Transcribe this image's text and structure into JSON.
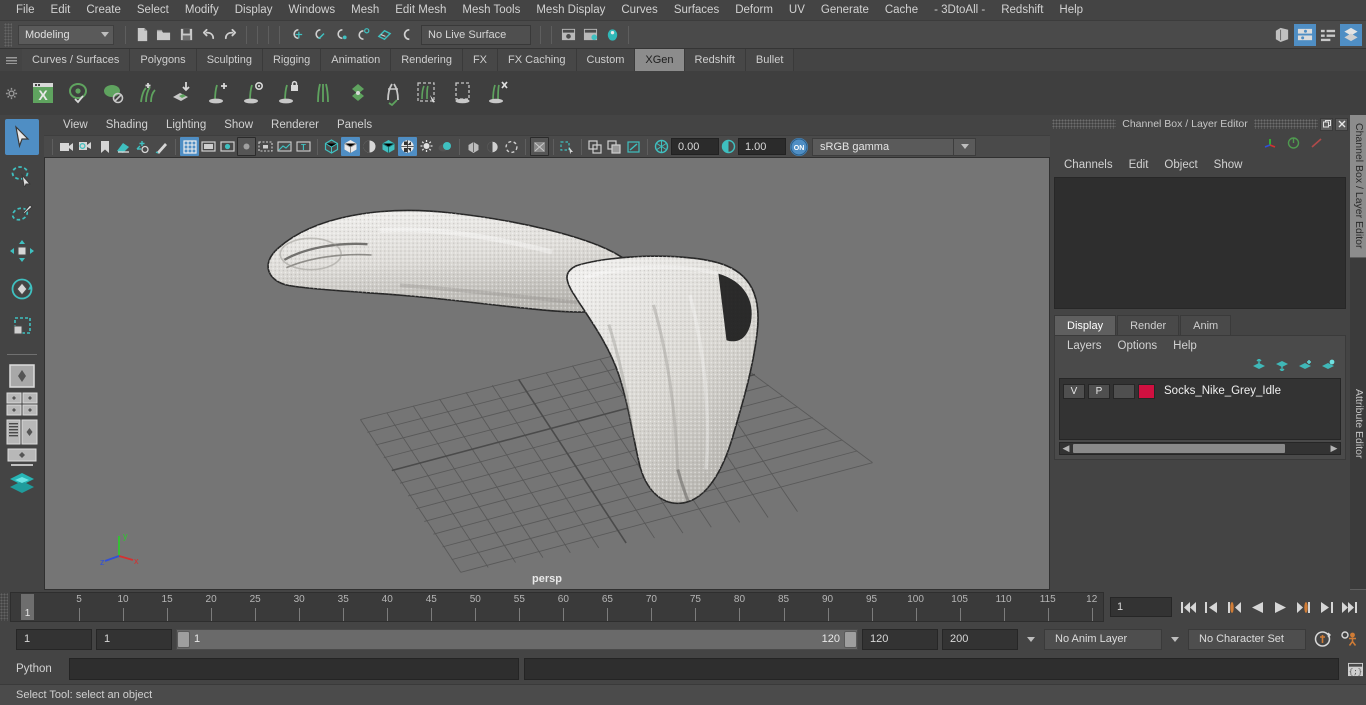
{
  "menubar": {
    "items": [
      "File",
      "Edit",
      "Create",
      "Select",
      "Modify",
      "Display",
      "Windows",
      "Mesh",
      "Edit Mesh",
      "Mesh Tools",
      "Mesh Display",
      "Curves",
      "Surfaces",
      "Deform",
      "UV",
      "Generate",
      "Cache",
      "- 3DtoAll -",
      "Redshift",
      "Help"
    ]
  },
  "statusbar": {
    "menuset": "Modeling",
    "live_surface": "No Live Surface",
    "icons": [
      "new-scene-icon",
      "open-scene-icon",
      "save-scene-icon",
      "undo-icon",
      "redo-icon",
      "snap-to-grid-icon",
      "snap-to-curve-icon",
      "snap-to-point-icon",
      "snap-to-projected-center-icon",
      "snap-to-view-plane-icon",
      "make-live-icon",
      "show-hide-render-view-icon",
      "render-current-frame-icon",
      "ipr-render-icon",
      "render-settings-icon"
    ],
    "right_icons": [
      "show-hide-modeling-toolkit-icon",
      "show-hide-attribute-editor-icon",
      "show-hide-tool-settings-icon",
      "show-hide-channel-box-icon"
    ]
  },
  "shelf": {
    "tabs": [
      "Curves / Surfaces",
      "Polygons",
      "Sculpting",
      "Rigging",
      "Animation",
      "Rendering",
      "FX",
      "FX Caching",
      "Custom",
      "XGen",
      "Redshift",
      "Bullet"
    ],
    "active_tab": "XGen",
    "icons": [
      "xgen-editor-icon",
      "xgen-preview-icon",
      "xgen-disable-preview-icon",
      "xgen-add-description-icon",
      "xgen-export-patches-icon",
      "xgen-add-guide-icon",
      "xgen-preview-guide-icon",
      "xgen-lock-guide-icon",
      "xgen-guide-split-icon",
      "xgen-groom-icon",
      "xgen-guide-tools-icon",
      "xgen-select-guide-icon",
      "xgen-region-icon",
      "xgen-delete-icon"
    ]
  },
  "viewport": {
    "menu": [
      "View",
      "Shading",
      "Lighting",
      "Show",
      "Renderer",
      "Panels"
    ],
    "camera_label": "persp",
    "exposure": "0.00",
    "gamma": "1.00",
    "color_profile": "sRGB gamma",
    "view_transform_state": "ON",
    "toolbar_icons": [
      "select-camera-icon",
      "camera-attributes-icon",
      "bookmark-icon",
      "image-plane-icon",
      "2d-pan-zoom-icon",
      "grease-pencil-icon",
      "grid-toggle-icon",
      "film-gate-icon",
      "resolution-gate-icon",
      "gate-mask-icon",
      "film-origin-icon",
      "safe-action-icon",
      "text-overlay-icon",
      "wireframe-icon",
      "smooth-shade-icon",
      "shaded-wireframe-icon",
      "textured-icon",
      "use-default-material-icon",
      "lighting-icon",
      "shadows-icon",
      "ao-icon",
      "motion-blur-icon",
      "multisample-icon",
      "isolate-select-icon",
      "xray-icon",
      "xray-joints-icon",
      "xray-components-icon",
      "exposure-icon",
      "gamma-icon"
    ],
    "axis_gizmo": {
      "x": "x",
      "y": "y",
      "z": "z",
      "x_color": "#e03c3c",
      "y_color": "#3ccb3c",
      "z_color": "#3c5ce0"
    }
  },
  "channel_box": {
    "title": "Channel Box / Layer Editor",
    "menu": [
      "Channels",
      "Edit",
      "Object",
      "Show"
    ],
    "window_buttons": [
      "restore-icon",
      "close-icon"
    ],
    "header_icons": [
      "axis-display-icon",
      "circle-display-icon",
      "slash-display-icon"
    ]
  },
  "layer_editor": {
    "tabs": [
      "Display",
      "Render",
      "Anim"
    ],
    "active_tab": "Display",
    "menu": [
      "Layers",
      "Options",
      "Help"
    ],
    "buttons": [
      "move-layer-up-icon",
      "move-layer-down-icon",
      "new-layer-icon",
      "new-layer-from-selection-icon"
    ],
    "layers": [
      {
        "visibility": "V",
        "playback": "P",
        "shading": "",
        "color": "#d01040",
        "name": "Socks_Nike_Grey_Idle"
      }
    ]
  },
  "timeline": {
    "current_frame": "1",
    "frame_field": "1",
    "ticks": [
      "5",
      "10",
      "15",
      "20",
      "25",
      "30",
      "35",
      "40",
      "45",
      "50",
      "55",
      "60",
      "65",
      "70",
      "75",
      "80",
      "85",
      "90",
      "95",
      "100",
      "105",
      "110",
      "115",
      "12"
    ],
    "playback_buttons": [
      "go-to-start-icon",
      "step-back-frame-icon",
      "step-back-key-icon",
      "play-backwards-icon",
      "play-forwards-icon",
      "step-forward-key-icon",
      "step-forward-frame-icon",
      "go-to-end-icon"
    ]
  },
  "range": {
    "anim_start": "1",
    "range_start": "1",
    "slider_min": "1",
    "slider_max": "120",
    "range_end": "120",
    "anim_end": "200",
    "anim_layer": "No Anim Layer",
    "character_set": "No Character Set",
    "right_icons": [
      "auto-keyframe-icon",
      "animation-preferences-icon"
    ]
  },
  "command_line": {
    "language": "Python",
    "input_value": "",
    "output_value": "",
    "script_editor_icon": "script-editor-icon"
  },
  "help_line": {
    "text": "Select Tool: select an object"
  },
  "toolbox": {
    "tools": [
      "select-tool",
      "lasso-select-tool",
      "paint-select-tool",
      "move-tool",
      "rotate-tool",
      "scale-tool"
    ],
    "active_tool": "select-tool",
    "layout_icons": [
      "single-perspective-layout-icon",
      "four-view-layout-icon",
      "persp-outliner-layout-icon",
      "persp-graph-layout-icon",
      "hypershade-layout-icon"
    ]
  },
  "colors": {
    "accent_blue": "#4f8ec4",
    "shelf_green": "#5fa35f",
    "orange": "#d07c36",
    "viewport_bg": "#757575",
    "panel_bg": "#444444"
  }
}
